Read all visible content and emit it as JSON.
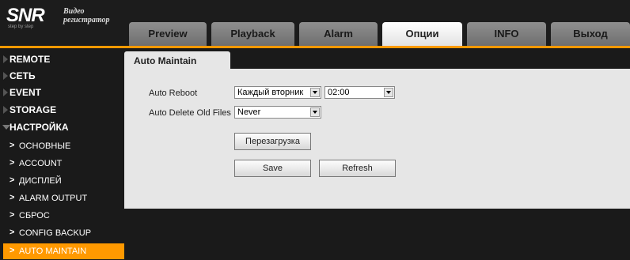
{
  "logo": {
    "brand": "SNR",
    "tagline": "step by step",
    "caption_line1": "Видео",
    "caption_line2": "регистратор"
  },
  "tabs": [
    {
      "label": "Preview",
      "active": false
    },
    {
      "label": "Playback",
      "active": false
    },
    {
      "label": "Alarm",
      "active": false
    },
    {
      "label": "Опции",
      "active": true
    },
    {
      "label": "INFO",
      "active": false
    },
    {
      "label": "Выход",
      "active": false
    }
  ],
  "sidebar": {
    "groups": [
      {
        "label": "REMOTE",
        "expanded": false
      },
      {
        "label": "СЕТЬ",
        "expanded": false
      },
      {
        "label": "EVENT",
        "expanded": false
      },
      {
        "label": "STORAGE",
        "expanded": false
      },
      {
        "label": "НАСТРОЙКА",
        "expanded": true
      }
    ],
    "subitems": [
      {
        "label": "ОСНОВНЫЕ",
        "active": false
      },
      {
        "label": "ACCOUNT",
        "active": false
      },
      {
        "label": "ДИСПЛЕЙ",
        "active": false
      },
      {
        "label": "ALARM OUTPUT",
        "active": false
      },
      {
        "label": "СБРОС",
        "active": false
      },
      {
        "label": "CONFIG BACKUP",
        "active": false
      },
      {
        "label": "AUTO MAINTAIN",
        "active": true
      }
    ],
    "chevron": ">"
  },
  "page": {
    "title": "Auto Maintain",
    "auto_reboot": {
      "label": "Auto Reboot",
      "day_value": "Каждый вторник",
      "time_value": "02:00"
    },
    "auto_delete": {
      "label": "Auto Delete Old Files",
      "value": "Never"
    },
    "buttons": {
      "reboot": "Перезагрузка",
      "save": "Save",
      "refresh": "Refresh"
    }
  },
  "colors": {
    "accent": "#ff9900",
    "panel_bg": "#e6e6e6",
    "header_bg": "#1c1c1c"
  }
}
